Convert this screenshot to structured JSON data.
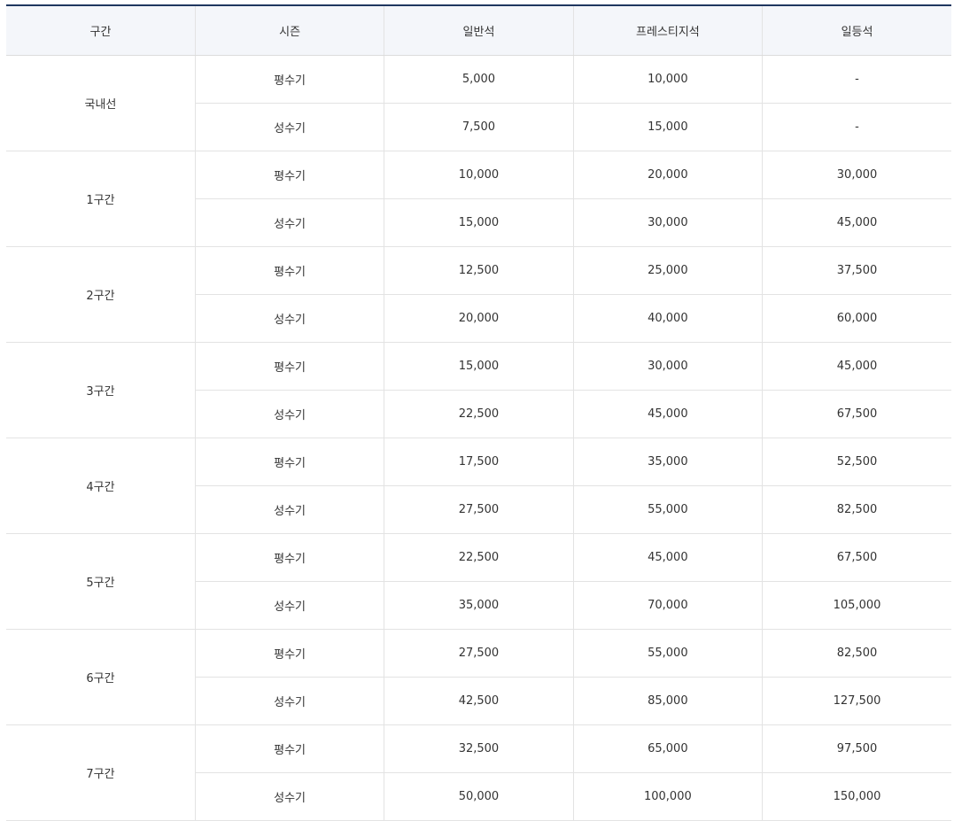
{
  "headers": [
    "구간",
    "시즌",
    "일반석",
    "프레스티지석",
    "일등석"
  ],
  "sections": [
    {
      "name": "국내선",
      "rows": [
        {
          "season": "평수기",
          "economy": "5,000",
          "prestige": "10,000",
          "first": "-"
        },
        {
          "season": "성수기",
          "economy": "7,500",
          "prestige": "15,000",
          "first": "-"
        }
      ]
    },
    {
      "name": "1구간",
      "rows": [
        {
          "season": "평수기",
          "economy": "10,000",
          "prestige": "20,000",
          "first": "30,000"
        },
        {
          "season": "성수기",
          "economy": "15,000",
          "prestige": "30,000",
          "first": "45,000"
        }
      ]
    },
    {
      "name": "2구간",
      "rows": [
        {
          "season": "평수기",
          "economy": "12,500",
          "prestige": "25,000",
          "first": "37,500"
        },
        {
          "season": "성수기",
          "economy": "20,000",
          "prestige": "40,000",
          "first": "60,000"
        }
      ]
    },
    {
      "name": "3구간",
      "rows": [
        {
          "season": "평수기",
          "economy": "15,000",
          "prestige": "30,000",
          "first": "45,000"
        },
        {
          "season": "성수기",
          "economy": "22,500",
          "prestige": "45,000",
          "first": "67,500"
        }
      ]
    },
    {
      "name": "4구간",
      "rows": [
        {
          "season": "평수기",
          "economy": "17,500",
          "prestige": "35,000",
          "first": "52,500"
        },
        {
          "season": "성수기",
          "economy": "27,500",
          "prestige": "55,000",
          "first": "82,500"
        }
      ]
    },
    {
      "name": "5구간",
      "rows": [
        {
          "season": "평수기",
          "economy": "22,500",
          "prestige": "45,000",
          "first": "67,500"
        },
        {
          "season": "성수기",
          "economy": "35,000",
          "prestige": "70,000",
          "first": "105,000"
        }
      ]
    },
    {
      "name": "6구간",
      "rows": [
        {
          "season": "평수기",
          "economy": "27,500",
          "prestige": "55,000",
          "first": "82,500"
        },
        {
          "season": "성수기",
          "economy": "42,500",
          "prestige": "85,000",
          "first": "127,500"
        }
      ]
    },
    {
      "name": "7구간",
      "rows": [
        {
          "season": "평수기",
          "economy": "32,500",
          "prestige": "65,000",
          "first": "97,500"
        },
        {
          "season": "성수기",
          "economy": "50,000",
          "prestige": "100,000",
          "first": "150,000"
        }
      ]
    }
  ]
}
